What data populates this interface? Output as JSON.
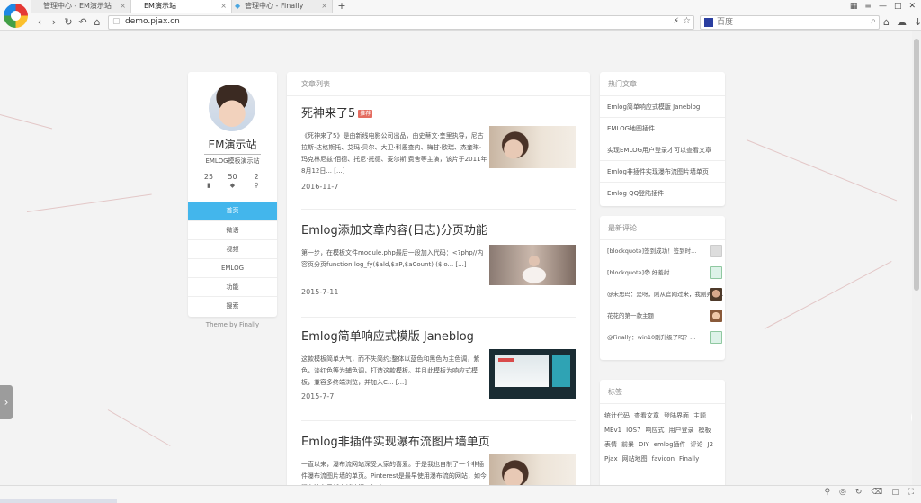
{
  "browser": {
    "tabs": [
      {
        "label": "管理中心 - EM演示站"
      },
      {
        "label": "EM演示站"
      },
      {
        "label": "管理中心 - Finally"
      }
    ],
    "address": "demo.pjax.cn",
    "search_placeholder": "百度"
  },
  "profile": {
    "name": "EM演示站",
    "subtitle": "EMLOG模板演示站",
    "stats": [
      {
        "value": "25",
        "icon": "file-icon"
      },
      {
        "value": "50",
        "icon": "tag-icon"
      },
      {
        "value": "2",
        "icon": "link-icon"
      }
    ],
    "menu": [
      "首页",
      "微语",
      "视频",
      "EMLOG",
      "功能",
      "搜索"
    ],
    "theme_credit": "Theme by Finally"
  },
  "main": {
    "heading": "文章列表",
    "articles": [
      {
        "title": "死神来了5",
        "badge": "推荐",
        "excerpt": "《死神来了5》是由新线电影公司出品，由史蒂文·奎里执导，尼古拉斯·达格斯托、艾玛·贝尔、大卫·科恩查内、梅甘·欧瑞、杰奎琳·玛克林尼兹·佰德、托尼·托德、麦尔斯·费舍等主演，该片于2011年8月12日... [...]",
        "date": "2016-11-7"
      },
      {
        "title": "Emlog添加文章内容(日志)分页功能",
        "badge": "",
        "excerpt": "第一步，在模板文件module.php最后一段加入代码：<?php//内容页分页function log_fy($ald,$aP,$aCount) ($lo... [...]",
        "date": "2015-7-11"
      },
      {
        "title": "Emlog简单响应式模版 Janeblog",
        "badge": "",
        "excerpt": "这款模板简单大气，而不失简约;整体以蓝色和黑色为主色调，紫色，淡红色等为辅色调，打造这款模板。并且此模板为响应式模板，兼容多终端浏览，并加入C... [...]",
        "date": "2015-7-7"
      },
      {
        "title": "Emlog非插件实现瀑布流图片墙单页",
        "badge": "",
        "excerpt": "一直以来，瀑布流网站深受大家的喜爱。于是我也自制了一个非插件瀑布流图片墙的单页。Pinterest是最早使用瀑布流的网站，如今瀑布流布局越来越流行。[...]",
        "date": ""
      }
    ]
  },
  "hot": {
    "heading": "热门文章",
    "items": [
      "Emlog简单响应式模版 Janeblog",
      "EMLOG地图插件",
      "实现EMLOG用户登录才可以查看文章",
      "Emlog非插件实现瀑布流图片墙单页",
      "Emlog QQ登陆插件"
    ]
  },
  "comments": {
    "heading": "最新评论",
    "items": [
      "[blockquote]签到成功！签到时...",
      "[blockquote]😨 好羞射...",
      "@未思玛：是呀，刚从官网过来，我刚弄几...",
      "花花的第一款主题",
      "@Finally：win10刚升级了吗？..."
    ]
  },
  "tags": {
    "heading": "标签",
    "items": [
      "统计代码",
      "查看文章",
      "登陆界面",
      "主题",
      "MEv1",
      "IOS7",
      "响应式",
      "用户登录",
      "模板",
      "表情",
      "前景",
      "DIY",
      "emlog插件",
      "评论",
      "J2",
      "Pjax",
      "网站地图",
      "favicon",
      "Finally"
    ]
  }
}
